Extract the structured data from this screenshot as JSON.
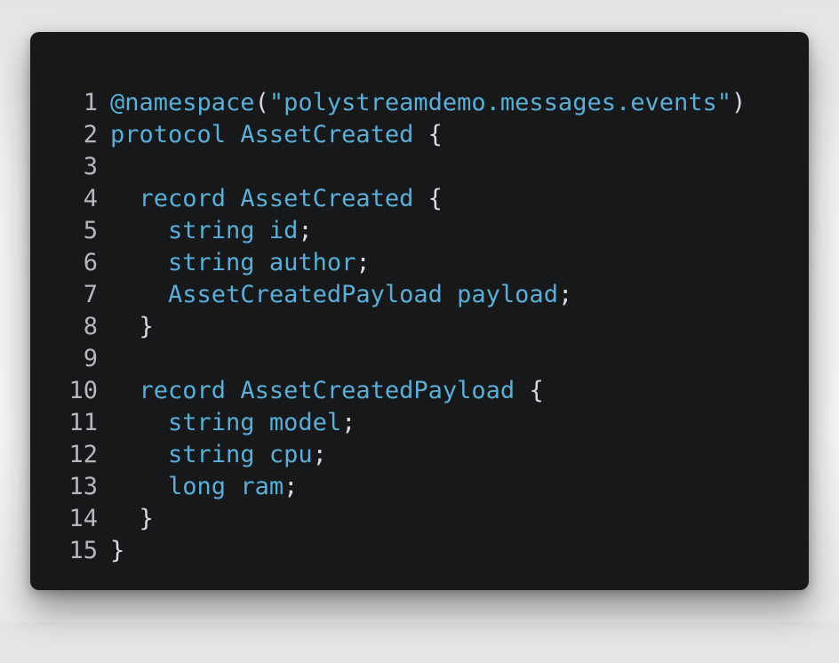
{
  "code": {
    "lines": [
      {
        "n": "1",
        "indent": "",
        "a": "@namespace",
        "b": "(",
        "c": "\"polystreamdemo.messages.events\"",
        "d": ")"
      },
      {
        "n": "2",
        "indent": "",
        "a": "protocol",
        "b": " ",
        "c": "AssetCreated",
        "d": " {"
      },
      {
        "n": "3",
        "indent": "",
        "a": "",
        "b": "",
        "c": "",
        "d": ""
      },
      {
        "n": "4",
        "indent": "  ",
        "a": "record",
        "b": " ",
        "c": "AssetCreated",
        "d": " {"
      },
      {
        "n": "5",
        "indent": "    ",
        "a": "string",
        "b": " ",
        "c": "id",
        "d": ";"
      },
      {
        "n": "6",
        "indent": "    ",
        "a": "string",
        "b": " ",
        "c": "author",
        "d": ";"
      },
      {
        "n": "7",
        "indent": "    ",
        "a": "AssetCreatedPayload",
        "b": " ",
        "c": "payload",
        "d": ";"
      },
      {
        "n": "8",
        "indent": "  ",
        "a": "",
        "b": "",
        "c": "",
        "d": "}"
      },
      {
        "n": "9",
        "indent": "",
        "a": "",
        "b": "",
        "c": "",
        "d": ""
      },
      {
        "n": "10",
        "indent": "  ",
        "a": "record",
        "b": " ",
        "c": "AssetCreatedPayload",
        "d": " {"
      },
      {
        "n": "11",
        "indent": "    ",
        "a": "string",
        "b": " ",
        "c": "model",
        "d": ";"
      },
      {
        "n": "12",
        "indent": "    ",
        "a": "string",
        "b": " ",
        "c": "cpu",
        "d": ";"
      },
      {
        "n": "13",
        "indent": "    ",
        "a": "long",
        "b": " ",
        "c": "ram",
        "d": ";"
      },
      {
        "n": "14",
        "indent": "  ",
        "a": "",
        "b": "",
        "c": "",
        "d": "}"
      },
      {
        "n": "15",
        "indent": "",
        "a": "",
        "b": "",
        "c": "",
        "d": "}"
      }
    ]
  },
  "colors": {
    "background": "#17181a",
    "keyword": "#5aaed8",
    "punctuation": "#d8dadd",
    "line_number": "#b5b7ba"
  }
}
